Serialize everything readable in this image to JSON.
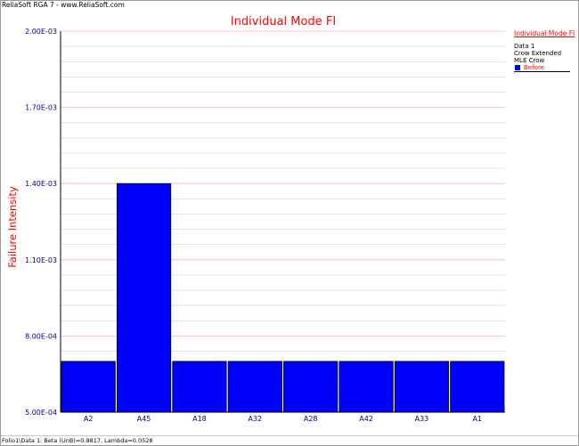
{
  "window": {
    "title": "ReliaSoft RGA 7 - www.ReliaSoft.com",
    "status": "Folio1\\Data 1: Beta (UnB)=0.8817, Lambda=0.0528"
  },
  "legend": {
    "title": "Individual Mode FI",
    "lines": [
      "Data 1",
      "Crow Extended",
      "MLE Crow"
    ],
    "entry": "Before"
  },
  "colors": {
    "bar": "#0000ff",
    "title": "#ff0000",
    "axis_text": "#000080",
    "major_grid": "#ffb0b0",
    "minor_grid": "#b8ecb8"
  },
  "chart_data": {
    "type": "bar",
    "title": "Individual Mode FI",
    "ylabel": "Failure Intensity",
    "xlabel": "",
    "categories": [
      "A2",
      "A45",
      "A18",
      "A32",
      "A28",
      "A42",
      "A33",
      "A1"
    ],
    "series": [
      {
        "name": "Before",
        "values": [
          0.0007,
          0.0014,
          0.0007,
          0.0007,
          0.0007,
          0.0007,
          0.0007,
          0.0007
        ]
      }
    ],
    "ylim": [
      0.0005,
      0.002
    ],
    "yticks": [
      0.0005,
      0.0008,
      0.0011,
      0.0014,
      0.0017,
      0.002
    ],
    "ytick_labels": [
      "5.00E-04",
      "8.00E-04",
      "1.10E-03",
      "1.40E-03",
      "1.70E-03",
      "2.00E-03"
    ],
    "grid": true,
    "legend_position": "right"
  }
}
